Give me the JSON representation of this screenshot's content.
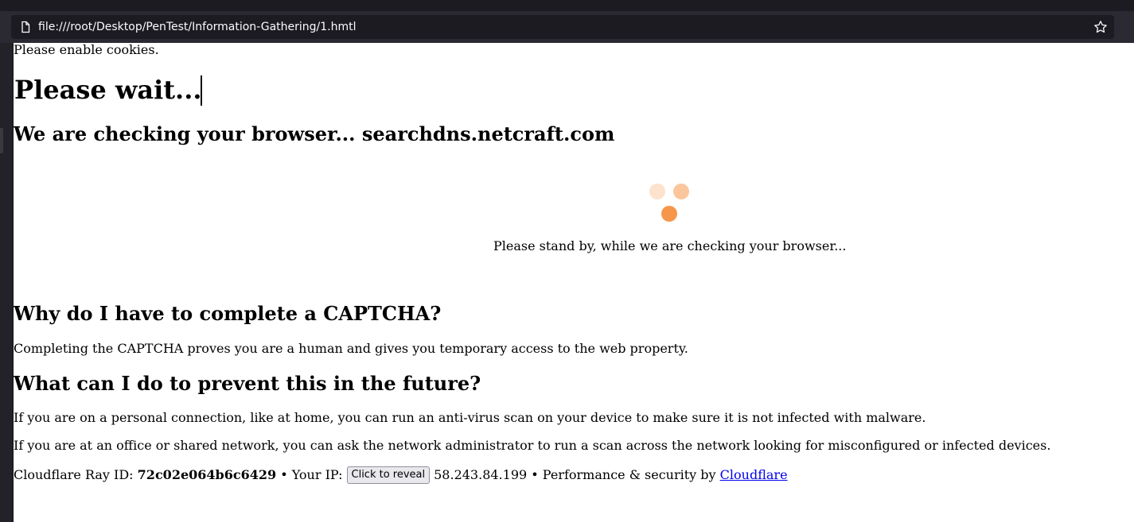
{
  "browser": {
    "url": "file:///root/Desktop/PenTest/Information-Gathering/1.hmtl"
  },
  "page": {
    "cookies_notice": "Please enable cookies.",
    "title": "Please wait...",
    "checking": "We are checking your browser... searchdns.netcraft.com",
    "standby": "Please stand by, while we are checking your browser...",
    "why_heading": "Why do I have to complete a CAPTCHA?",
    "why_text": "Completing the CAPTCHA proves you are a human and gives you temporary access to the web property.",
    "prevent_heading": "What can I do to prevent this in the future?",
    "prevent_text_1": "If you are on a personal connection, like at home, you can run an anti-virus scan on your device to make sure it is not infected with malware.",
    "prevent_text_2": "If you are at an office or shared network, you can ask the network administrator to run a scan across the network looking for misconfigured or infected devices."
  },
  "footer": {
    "ray_label": "Cloudflare Ray ID:",
    "ray_id": "72c02e064b6c6429",
    "ip_label": "• Your IP:",
    "reveal_button": "Click to reveal",
    "ip_value": "58.243.84.199",
    "perf_label": "• Performance & security by",
    "cloudflare_link": "Cloudflare"
  },
  "colors": {
    "spinner_light": "#fde2cd",
    "spinner_mid": "#fbc69c",
    "spinner_dark": "#f6964b",
    "link": "#0000ee"
  },
  "icons": [
    "page-icon",
    "star-icon"
  ]
}
